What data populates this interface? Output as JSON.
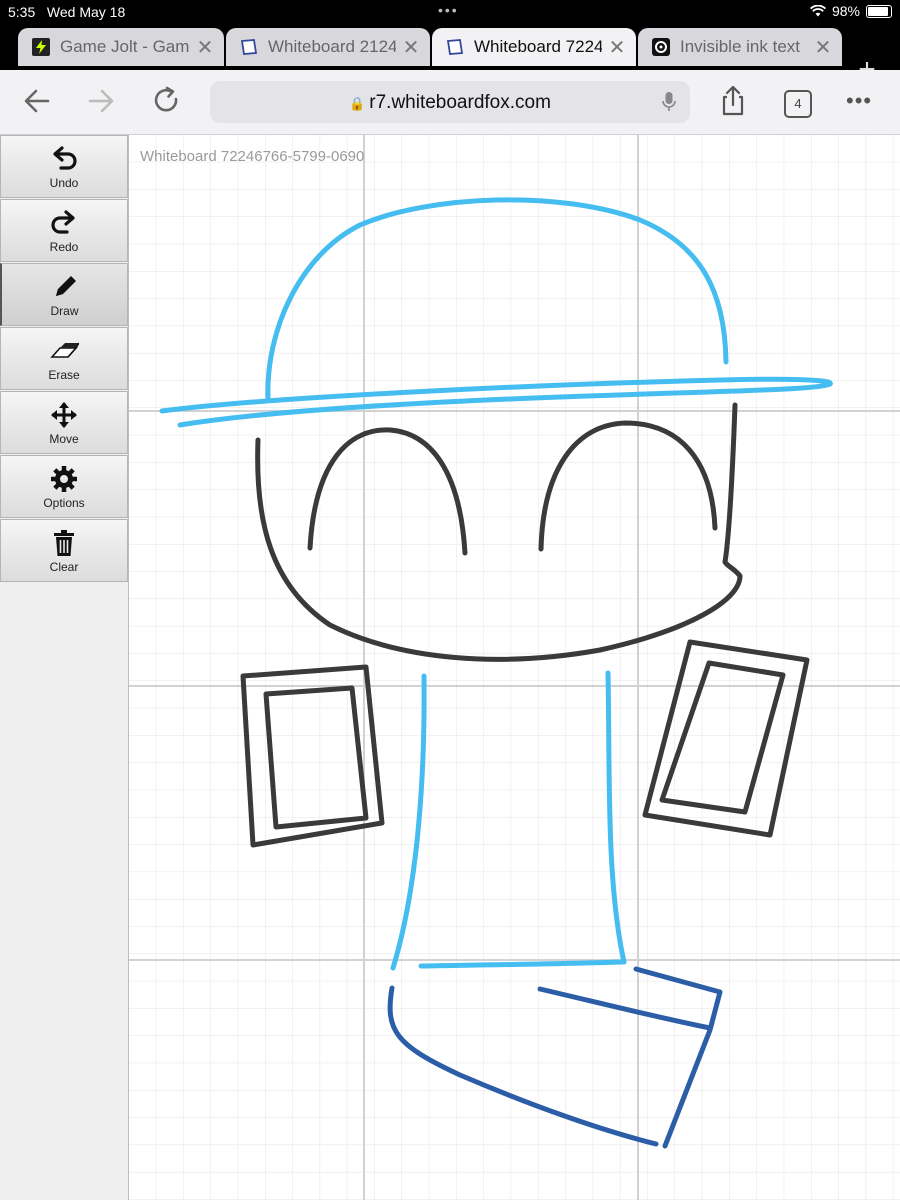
{
  "status": {
    "time": "5:35",
    "date": "Wed May 18",
    "battery": "98%"
  },
  "tabs": [
    {
      "title": "Game Jolt - Game",
      "active": false,
      "icon": "gamejolt-icon"
    },
    {
      "title": "Whiteboard 2124",
      "active": false,
      "icon": "whiteboard-icon"
    },
    {
      "title": "Whiteboard 7224",
      "active": true,
      "icon": "whiteboard-icon"
    },
    {
      "title": "Invisible ink text",
      "active": false,
      "icon": "invisible-ink-icon"
    }
  ],
  "toolbar": {
    "url": "r7.whiteboardfox.com",
    "tab_count": "4"
  },
  "sidebar": {
    "tools": [
      {
        "label": "Undo",
        "icon": "undo-icon"
      },
      {
        "label": "Redo",
        "icon": "redo-icon"
      },
      {
        "label": "Draw",
        "icon": "pencil-icon",
        "active": true
      },
      {
        "label": "Erase",
        "icon": "eraser-icon"
      },
      {
        "label": "Move",
        "icon": "move-icon"
      },
      {
        "label": "Options",
        "icon": "gear-icon"
      },
      {
        "label": "Clear",
        "icon": "trash-icon"
      }
    ]
  },
  "board": {
    "title": "Whiteboard 72246766-5799-0690",
    "colors": {
      "light_blue": "#45bdf0",
      "dark_gray": "#3a3a3a",
      "dark_blue": "#2c5ea8"
    }
  }
}
